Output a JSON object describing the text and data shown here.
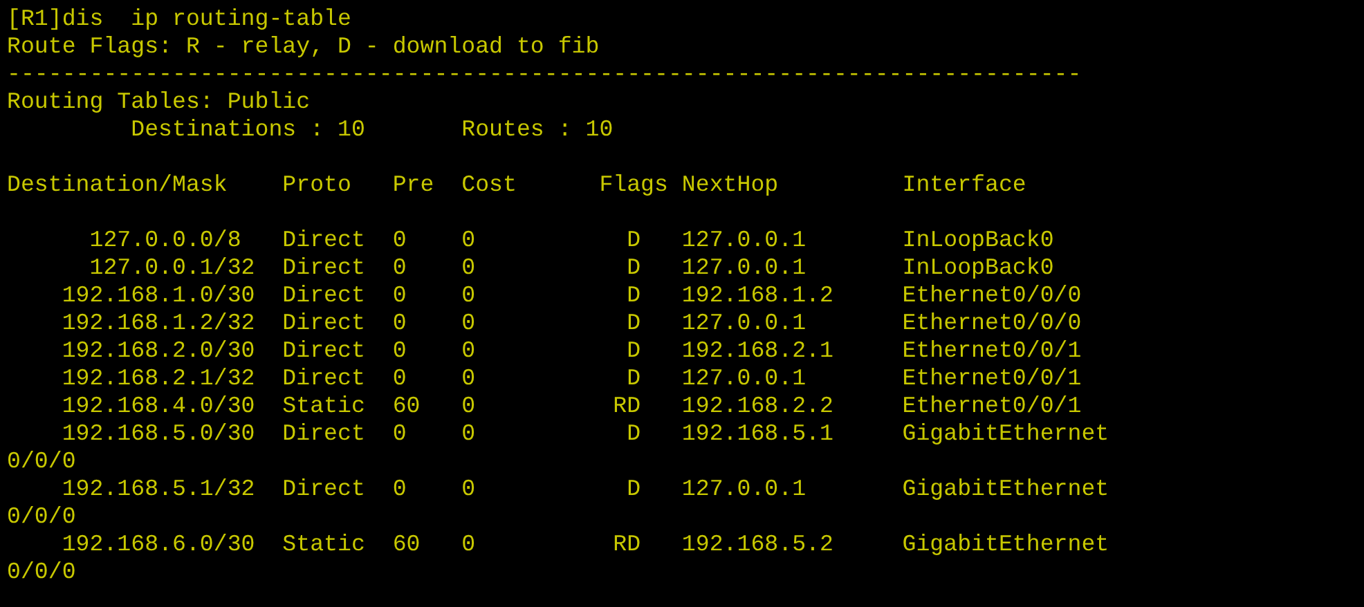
{
  "terminal": {
    "blocks": [
      [
        "[R1]dis  ip routing-table",
        "Route Flags: R - relay, D - download to fib",
        "------------------------------------------------------------------------------",
        "Routing Tables: Public",
        "         Destinations : 10       Routes : 10"
      ],
      [
        "Destination/Mask    Proto   Pre  Cost      Flags NextHop         Interface"
      ],
      [
        "      127.0.0.0/8   Direct  0    0           D   127.0.0.1       InLoopBack0",
        "      127.0.0.1/32  Direct  0    0           D   127.0.0.1       InLoopBack0",
        "    192.168.1.0/30  Direct  0    0           D   192.168.1.2     Ethernet0/0/0",
        "    192.168.1.2/32  Direct  0    0           D   127.0.0.1       Ethernet0/0/0",
        "    192.168.2.0/30  Direct  0    0           D   192.168.2.1     Ethernet0/0/1",
        "    192.168.2.1/32  Direct  0    0           D   127.0.0.1       Ethernet0/0/1",
        "    192.168.4.0/30  Static  60   0          RD   192.168.2.2     Ethernet0/0/1",
        "    192.168.5.0/30  Direct  0    0           D   192.168.5.1     GigabitEthernet",
        "0/0/0",
        "    192.168.5.1/32  Direct  0    0           D   127.0.0.1       GigabitEthernet",
        "0/0/0",
        "    192.168.6.0/30  Static  60   0          RD   192.168.5.2     GigabitEthernet",
        "0/0/0"
      ]
    ]
  }
}
